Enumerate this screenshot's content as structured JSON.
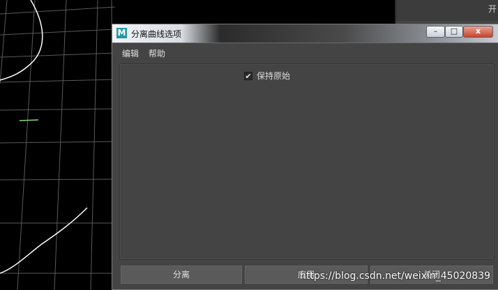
{
  "dialog": {
    "title": "分离曲线选项",
    "app_icon_letter": "M"
  },
  "window_buttons": {
    "minimize": "–",
    "maximize": "□",
    "close": "x"
  },
  "menu": {
    "edit": "编辑",
    "help": "帮助"
  },
  "options": {
    "keep_original": {
      "label": "保持原始",
      "checked": true,
      "check_mark": "✔"
    }
  },
  "actions": {
    "separate": "分离",
    "apply": "应用",
    "close": "关闭"
  },
  "side_panel": {
    "glyph": "开"
  },
  "watermark": "https://blog.csdn.net/weixin_45020839",
  "colors": {
    "viewport_bg": "#000000",
    "grid": "#5a5a5a",
    "curve": "#ffffff",
    "dialog_bg": "#444444",
    "close_button": "#c6452e"
  }
}
